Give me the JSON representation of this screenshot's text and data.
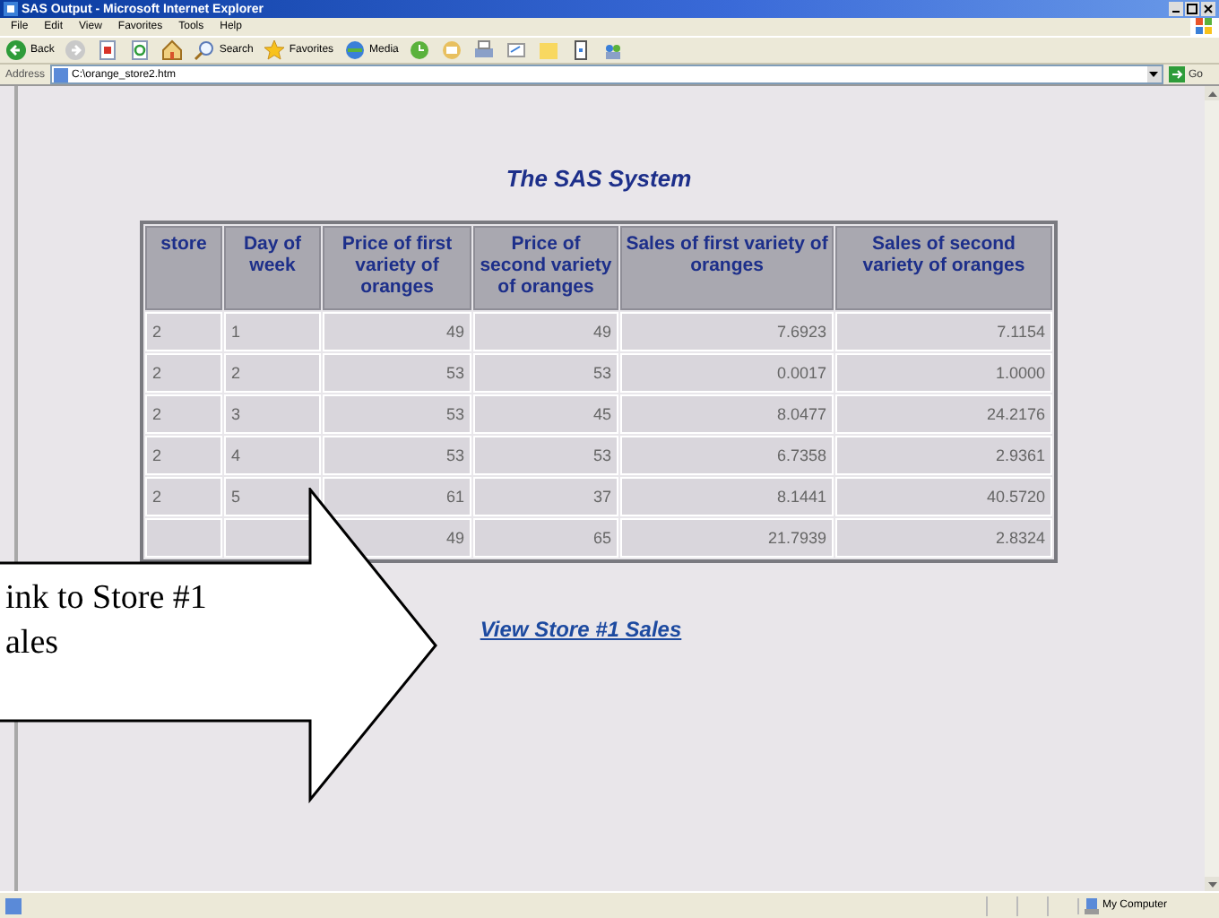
{
  "window": {
    "title": "SAS Output - Microsoft Internet Explorer"
  },
  "menu": [
    "File",
    "Edit",
    "View",
    "Favorites",
    "Tools",
    "Help"
  ],
  "toolbar": [
    {
      "kind": "back",
      "label": "Back"
    },
    {
      "kind": "forward"
    },
    {
      "kind": "stop"
    },
    {
      "kind": "refresh"
    },
    {
      "kind": "home"
    },
    {
      "kind": "search",
      "label": "Search"
    },
    {
      "kind": "favorites",
      "label": "Favorites"
    },
    {
      "kind": "media",
      "label": "Media"
    },
    {
      "kind": "history"
    },
    {
      "kind": "mail"
    },
    {
      "kind": "print"
    },
    {
      "kind": "edit"
    },
    {
      "kind": "folder"
    },
    {
      "kind": "phone"
    },
    {
      "kind": "messenger"
    }
  ],
  "address": {
    "label": "Address",
    "value": "C:\\orange_store2.htm",
    "go": "Go"
  },
  "page": {
    "title": "The SAS System",
    "table": {
      "columns": [
        "store",
        "Day of week",
        "Price of first variety of oranges",
        "Price of second variety of oranges",
        "Sales of first variety of oranges",
        "Sales of second variety of oranges"
      ],
      "rows": [
        {
          "cells": [
            "2",
            "1",
            "49",
            "49",
            "7.6923",
            "7.1154"
          ]
        },
        {
          "cells": [
            "2",
            "2",
            "53",
            "53",
            "0.0017",
            "1.0000"
          ]
        },
        {
          "cells": [
            "2",
            "3",
            "53",
            "45",
            "8.0477",
            "24.2176"
          ]
        },
        {
          "cells": [
            "2",
            "4",
            "53",
            "53",
            "6.7358",
            "2.9361"
          ]
        },
        {
          "cells": [
            "2",
            "5",
            "61",
            "37",
            "8.1441",
            "40.5720"
          ]
        },
        {
          "cells": [
            "",
            "",
            "49",
            "65",
            "21.7939",
            "2.8324"
          ]
        }
      ]
    },
    "link": "View Store #1 Sales"
  },
  "callout": {
    "lines": [
      "ink to Store #1",
      "ales"
    ]
  },
  "status_bar": {
    "zone": "My Computer"
  }
}
